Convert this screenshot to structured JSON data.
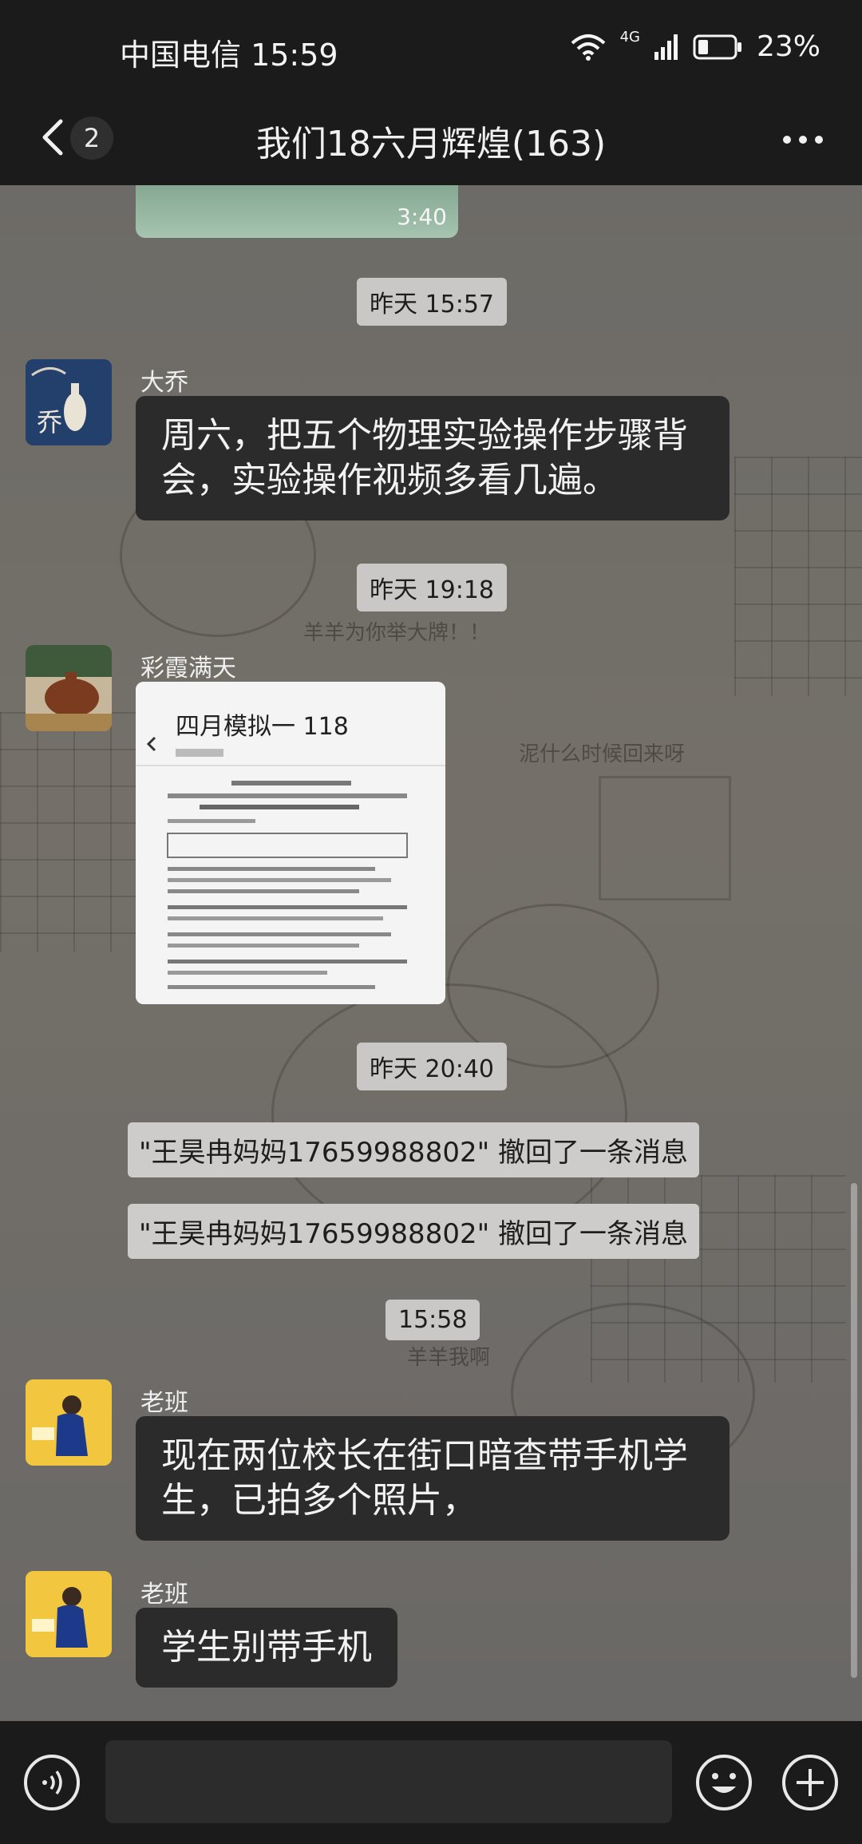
{
  "status_bar": {
    "carrier_time": "中国电信 15:59",
    "network": "4G",
    "battery": "23%"
  },
  "header": {
    "back_badge": "2",
    "title": "我们18六月辉煌(163)"
  },
  "chat": {
    "prev_voice_duration": "3:40",
    "background_doodles": [
      "羊羊为你举大牌！！",
      "泥什么时候回来呀",
      "羊羊我啊"
    ],
    "timestamps": [
      "昨天 15:57",
      "昨天 19:18",
      "昨天 20:40",
      "15:58"
    ],
    "messages": [
      {
        "sender": "大乔",
        "text": "周六，把五个物理实验操作步骤背会，实验操作视频多看几遍。",
        "line1": "周六，把五个物理实验操作步骤背",
        "line2": "会，实验操作视频多看几遍。",
        "avatar_char": "乔"
      },
      {
        "sender": "彩霞满天",
        "image_title": "四月模拟一 118"
      },
      {
        "recall_1": "\"王昊冉妈妈17659988802\" 撤回了一条消息",
        "recall_2": "\"王昊冉妈妈17659988802\" 撤回了一条消息"
      },
      {
        "sender": "老班",
        "line1": "现在两位校长在街口暗查带手机学",
        "line2": "生，已拍多个照片，"
      },
      {
        "sender": "老班",
        "text": "学生别带手机"
      }
    ]
  },
  "colors": {
    "bar": "#1b1b1b",
    "bubble": "#2b2b2b",
    "pill": "#c9c8c6"
  }
}
